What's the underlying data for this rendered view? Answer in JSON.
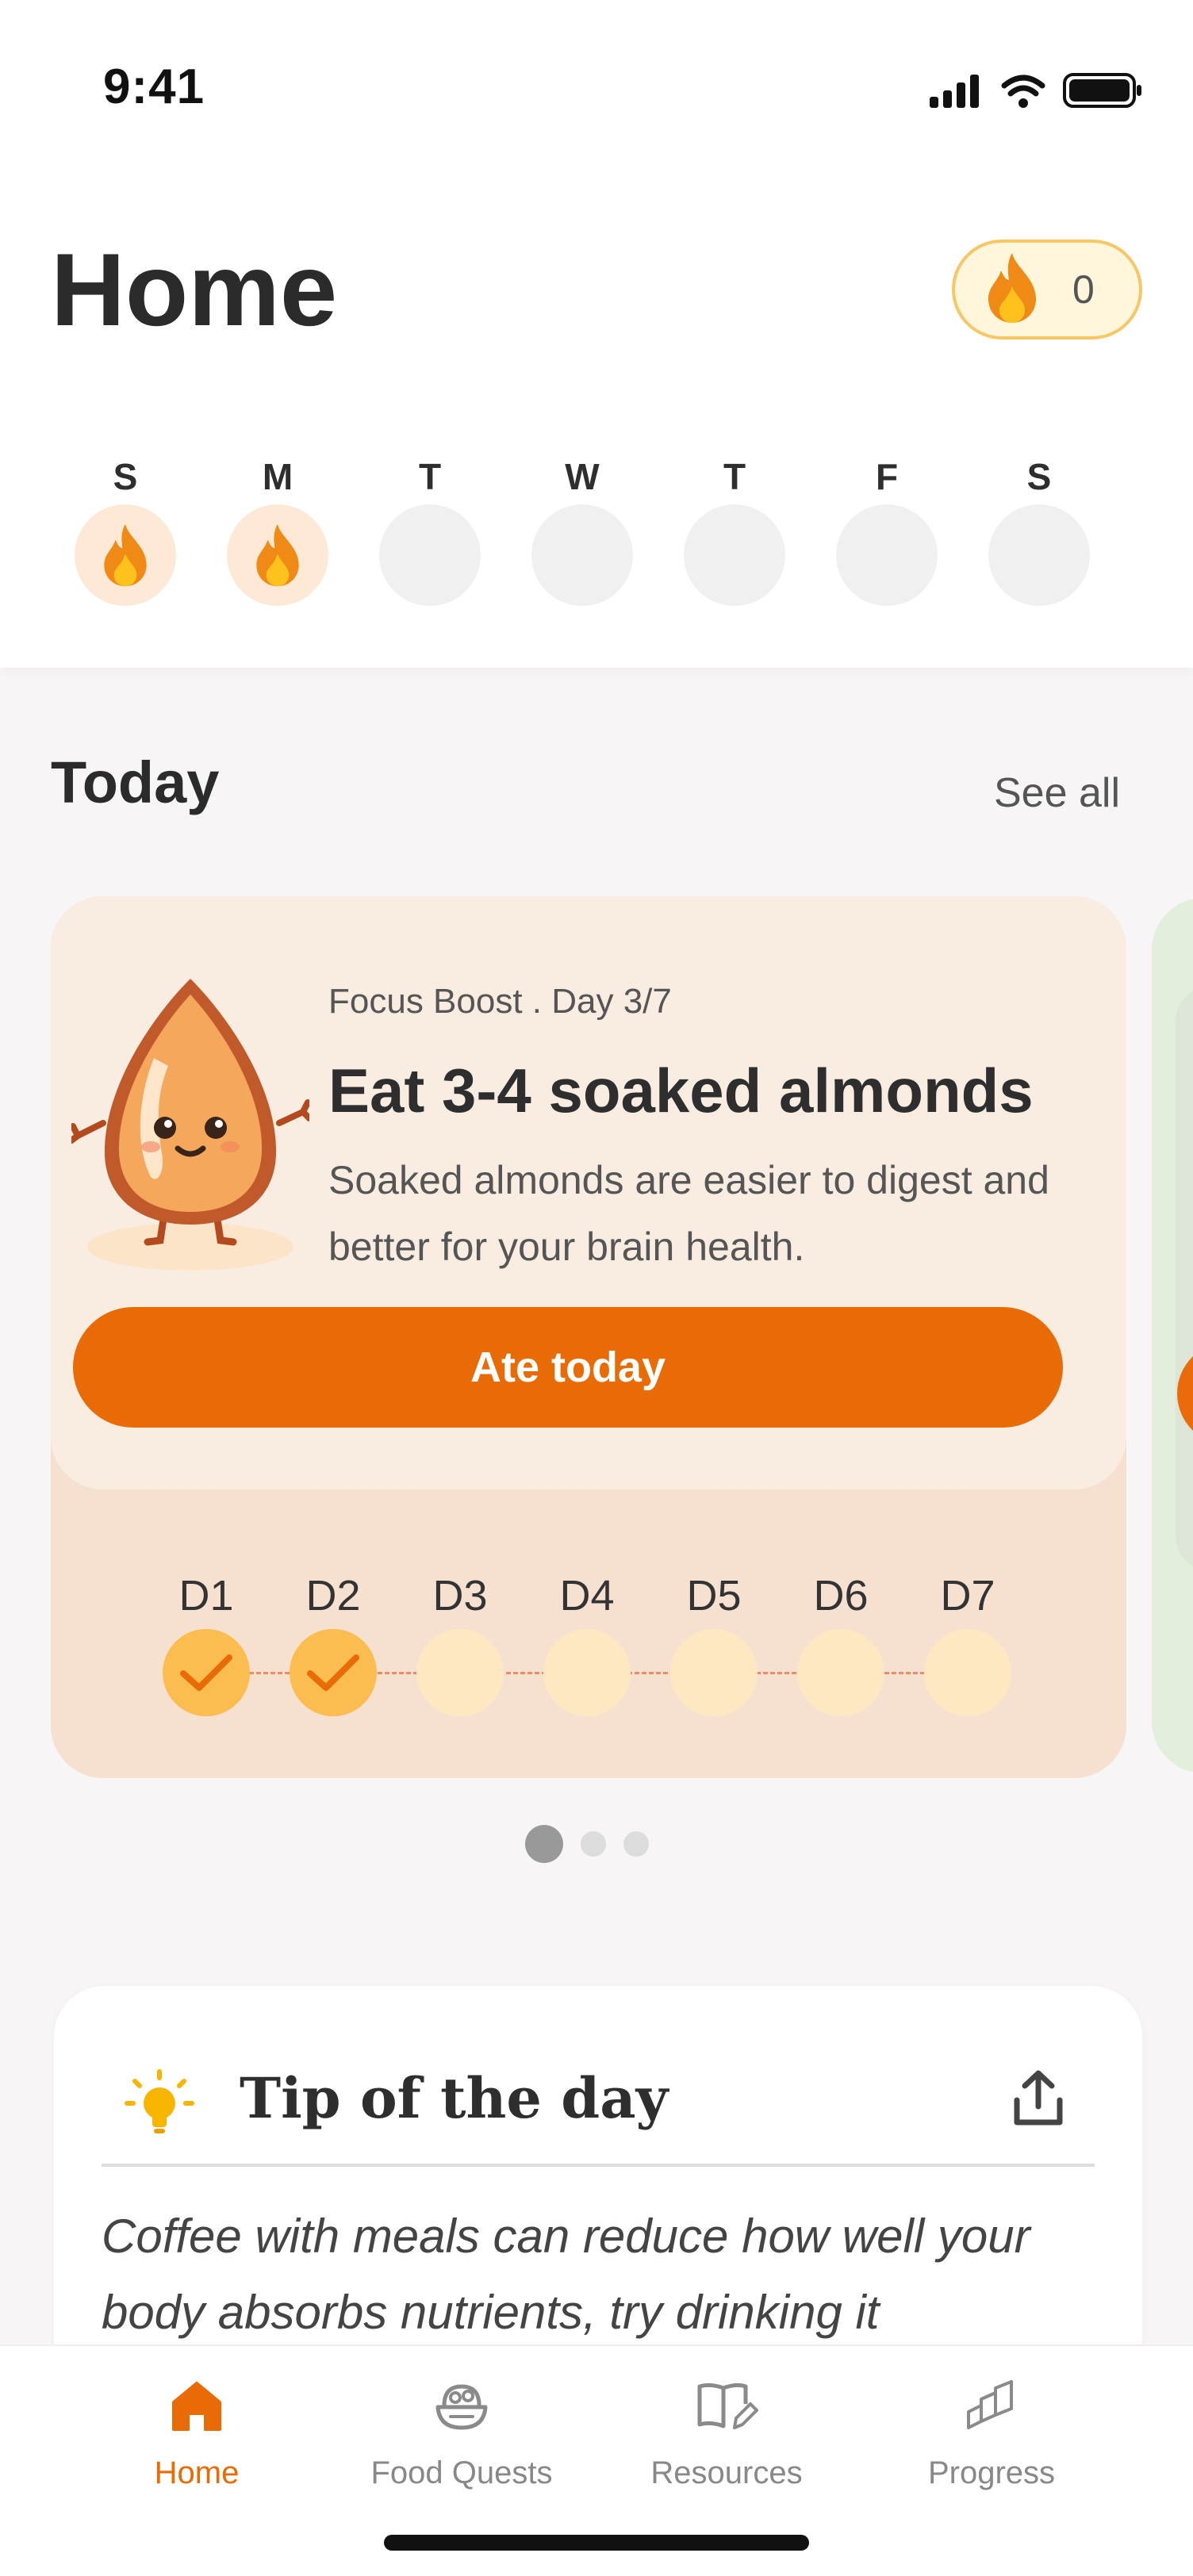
{
  "status_bar": {
    "time": "9:41"
  },
  "header": {
    "title": "Home",
    "streak_count": "0"
  },
  "week": {
    "days": [
      {
        "letter": "S",
        "done": true
      },
      {
        "letter": "M",
        "done": true
      },
      {
        "letter": "T",
        "done": false
      },
      {
        "letter": "W",
        "done": false
      },
      {
        "letter": "T",
        "done": false
      },
      {
        "letter": "F",
        "done": false
      },
      {
        "letter": "S",
        "done": false
      }
    ]
  },
  "today": {
    "section_title": "Today",
    "see_all": "See all",
    "card": {
      "eyebrow": "Focus Boost . Day 3/7",
      "title": "Eat 3-4 soaked almonds",
      "description": "Soaked almonds are easier to digest and better for your brain health.",
      "button_label": "Ate today",
      "progress": [
        {
          "label": "D1",
          "done": true
        },
        {
          "label": "D2",
          "done": true
        },
        {
          "label": "D3",
          "done": false
        },
        {
          "label": "D4",
          "done": false
        },
        {
          "label": "D5",
          "done": false
        },
        {
          "label": "D6",
          "done": false
        },
        {
          "label": "D7",
          "done": false
        }
      ]
    },
    "pager": {
      "count": 3,
      "active_index": 0
    }
  },
  "tip": {
    "title": "Tip of the day",
    "text": "Coffee with meals can reduce how well your body absorbs nutrients, try drinking it"
  },
  "nav": {
    "items": [
      {
        "label": "Home",
        "icon": "home-icon",
        "active": true
      },
      {
        "label": "Food Quests",
        "icon": "food-bowl-icon",
        "active": false
      },
      {
        "label": "Resources",
        "icon": "book-edit-icon",
        "active": false
      },
      {
        "label": "Progress",
        "icon": "progress-stairs-icon",
        "active": false
      }
    ]
  },
  "colors": {
    "accent": "#e96b06",
    "streak_done_bg": "#fde9d5",
    "day_done_dot": "#fbbd4f",
    "day_pending_dot": "#fde8c2",
    "card_bg": "#f6e1d1"
  }
}
